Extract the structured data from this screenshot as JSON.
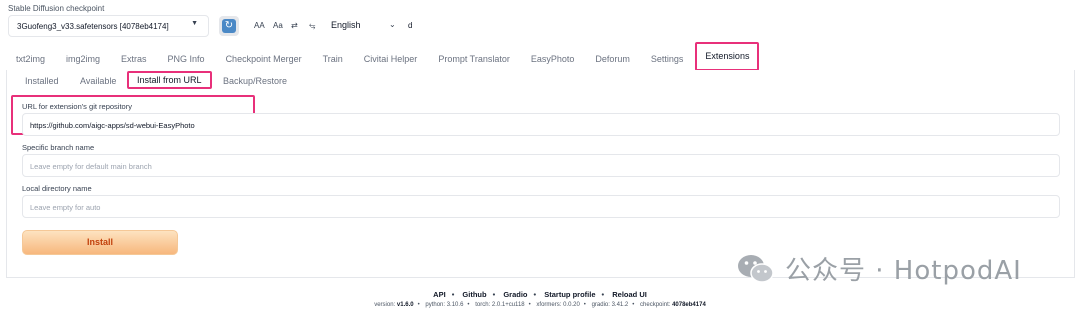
{
  "checkpoint": {
    "label": "Stable Diffusion checkpoint",
    "value": "3Guofeng3_v33.safetensors [4078eb4174]"
  },
  "toolbar": {
    "tool_1": "AA",
    "tool_2": "Aa",
    "tool_3": "⇄",
    "tool_4": "⥃"
  },
  "language": {
    "value": "English",
    "extra": "d"
  },
  "tabs": [
    "txt2img",
    "img2img",
    "Extras",
    "PNG Info",
    "Checkpoint Merger",
    "Train",
    "Civitai Helper",
    "Prompt Translator",
    "EasyPhoto",
    "Deforum",
    "Settings",
    "Extensions"
  ],
  "active_tab": "Extensions",
  "subtabs": [
    "Installed",
    "Available",
    "Install from URL",
    "Backup/Restore"
  ],
  "active_subtab": "Install from URL",
  "form": {
    "url_label": "URL for extension's git repository",
    "url_value": "https://github.com/aigc-apps/sd-webui-EasyPhoto",
    "branch_label": "Specific branch name",
    "branch_placeholder": "Leave empty for default main branch",
    "dir_label": "Local directory name",
    "dir_placeholder": "Leave empty for auto",
    "install_label": "Install"
  },
  "footer": {
    "links": [
      "API",
      "Github",
      "Gradio",
      "Startup profile",
      "Reload UI"
    ],
    "version_items": [
      {
        "k": "version: ",
        "v": "v1.6.0"
      },
      {
        "k": "python: ",
        "v": "3.10.6"
      },
      {
        "k": "torch: ",
        "v": "2.0.1+cu118"
      },
      {
        "k": "xformers: ",
        "v": "0.0.20"
      },
      {
        "k": "gradio: ",
        "v": "3.41.2"
      },
      {
        "k": "checkpoint: ",
        "v": "4078eb4174"
      }
    ]
  },
  "watermark": {
    "text": "公众号 · HotpodAI"
  },
  "colors": {
    "highlight": "#e8307a",
    "install_text": "#c2410c",
    "refresh_icon": "#4b89c6"
  }
}
